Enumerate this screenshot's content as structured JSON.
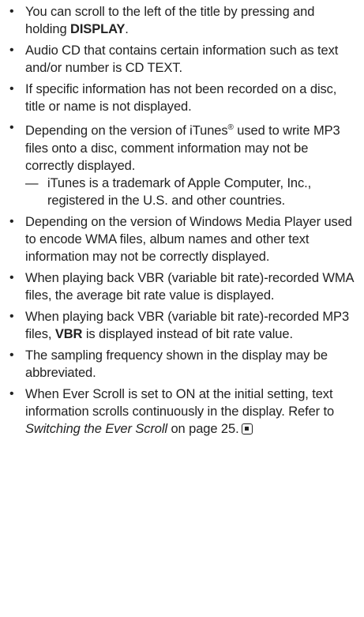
{
  "notes": [
    {
      "pre": "You can scroll to the left of the title by pressing and holding ",
      "bold": "DISPLAY",
      "post": "."
    },
    {
      "text": "Audio CD that contains certain information such as text and/or number is CD TEXT."
    },
    {
      "text": "If specific information has not been recorded on a disc, title or name is not displayed."
    },
    {
      "pre": "Depending on the version of iTunes",
      "sup": "®",
      "post": " used to write MP3 files onto a disc, comment information may not be correctly displayed.",
      "sub_dash": "—",
      "sub_text": "iTunes is a trademark of Apple Computer, Inc., registered in the U.S. and other countries."
    },
    {
      "text": "Depending on the version of Windows Media Player used to encode WMA files, album names and other text information may not be correctly displayed."
    },
    {
      "text": "When playing back VBR (variable bit rate)-recorded WMA files, the average bit rate value is displayed."
    },
    {
      "pre": "When playing back VBR (variable bit rate)-recorded MP3 files, ",
      "bold": "VBR",
      "post": " is displayed instead of bit rate value."
    },
    {
      "text": "The sampling frequency shown in the display may be abbreviated."
    },
    {
      "pre": "When Ever Scroll is set to ON at the initial setting, text information scrolls continuously in the display. Refer to ",
      "italic": "Switching the Ever Scroll",
      "post": " on page 25."
    }
  ]
}
